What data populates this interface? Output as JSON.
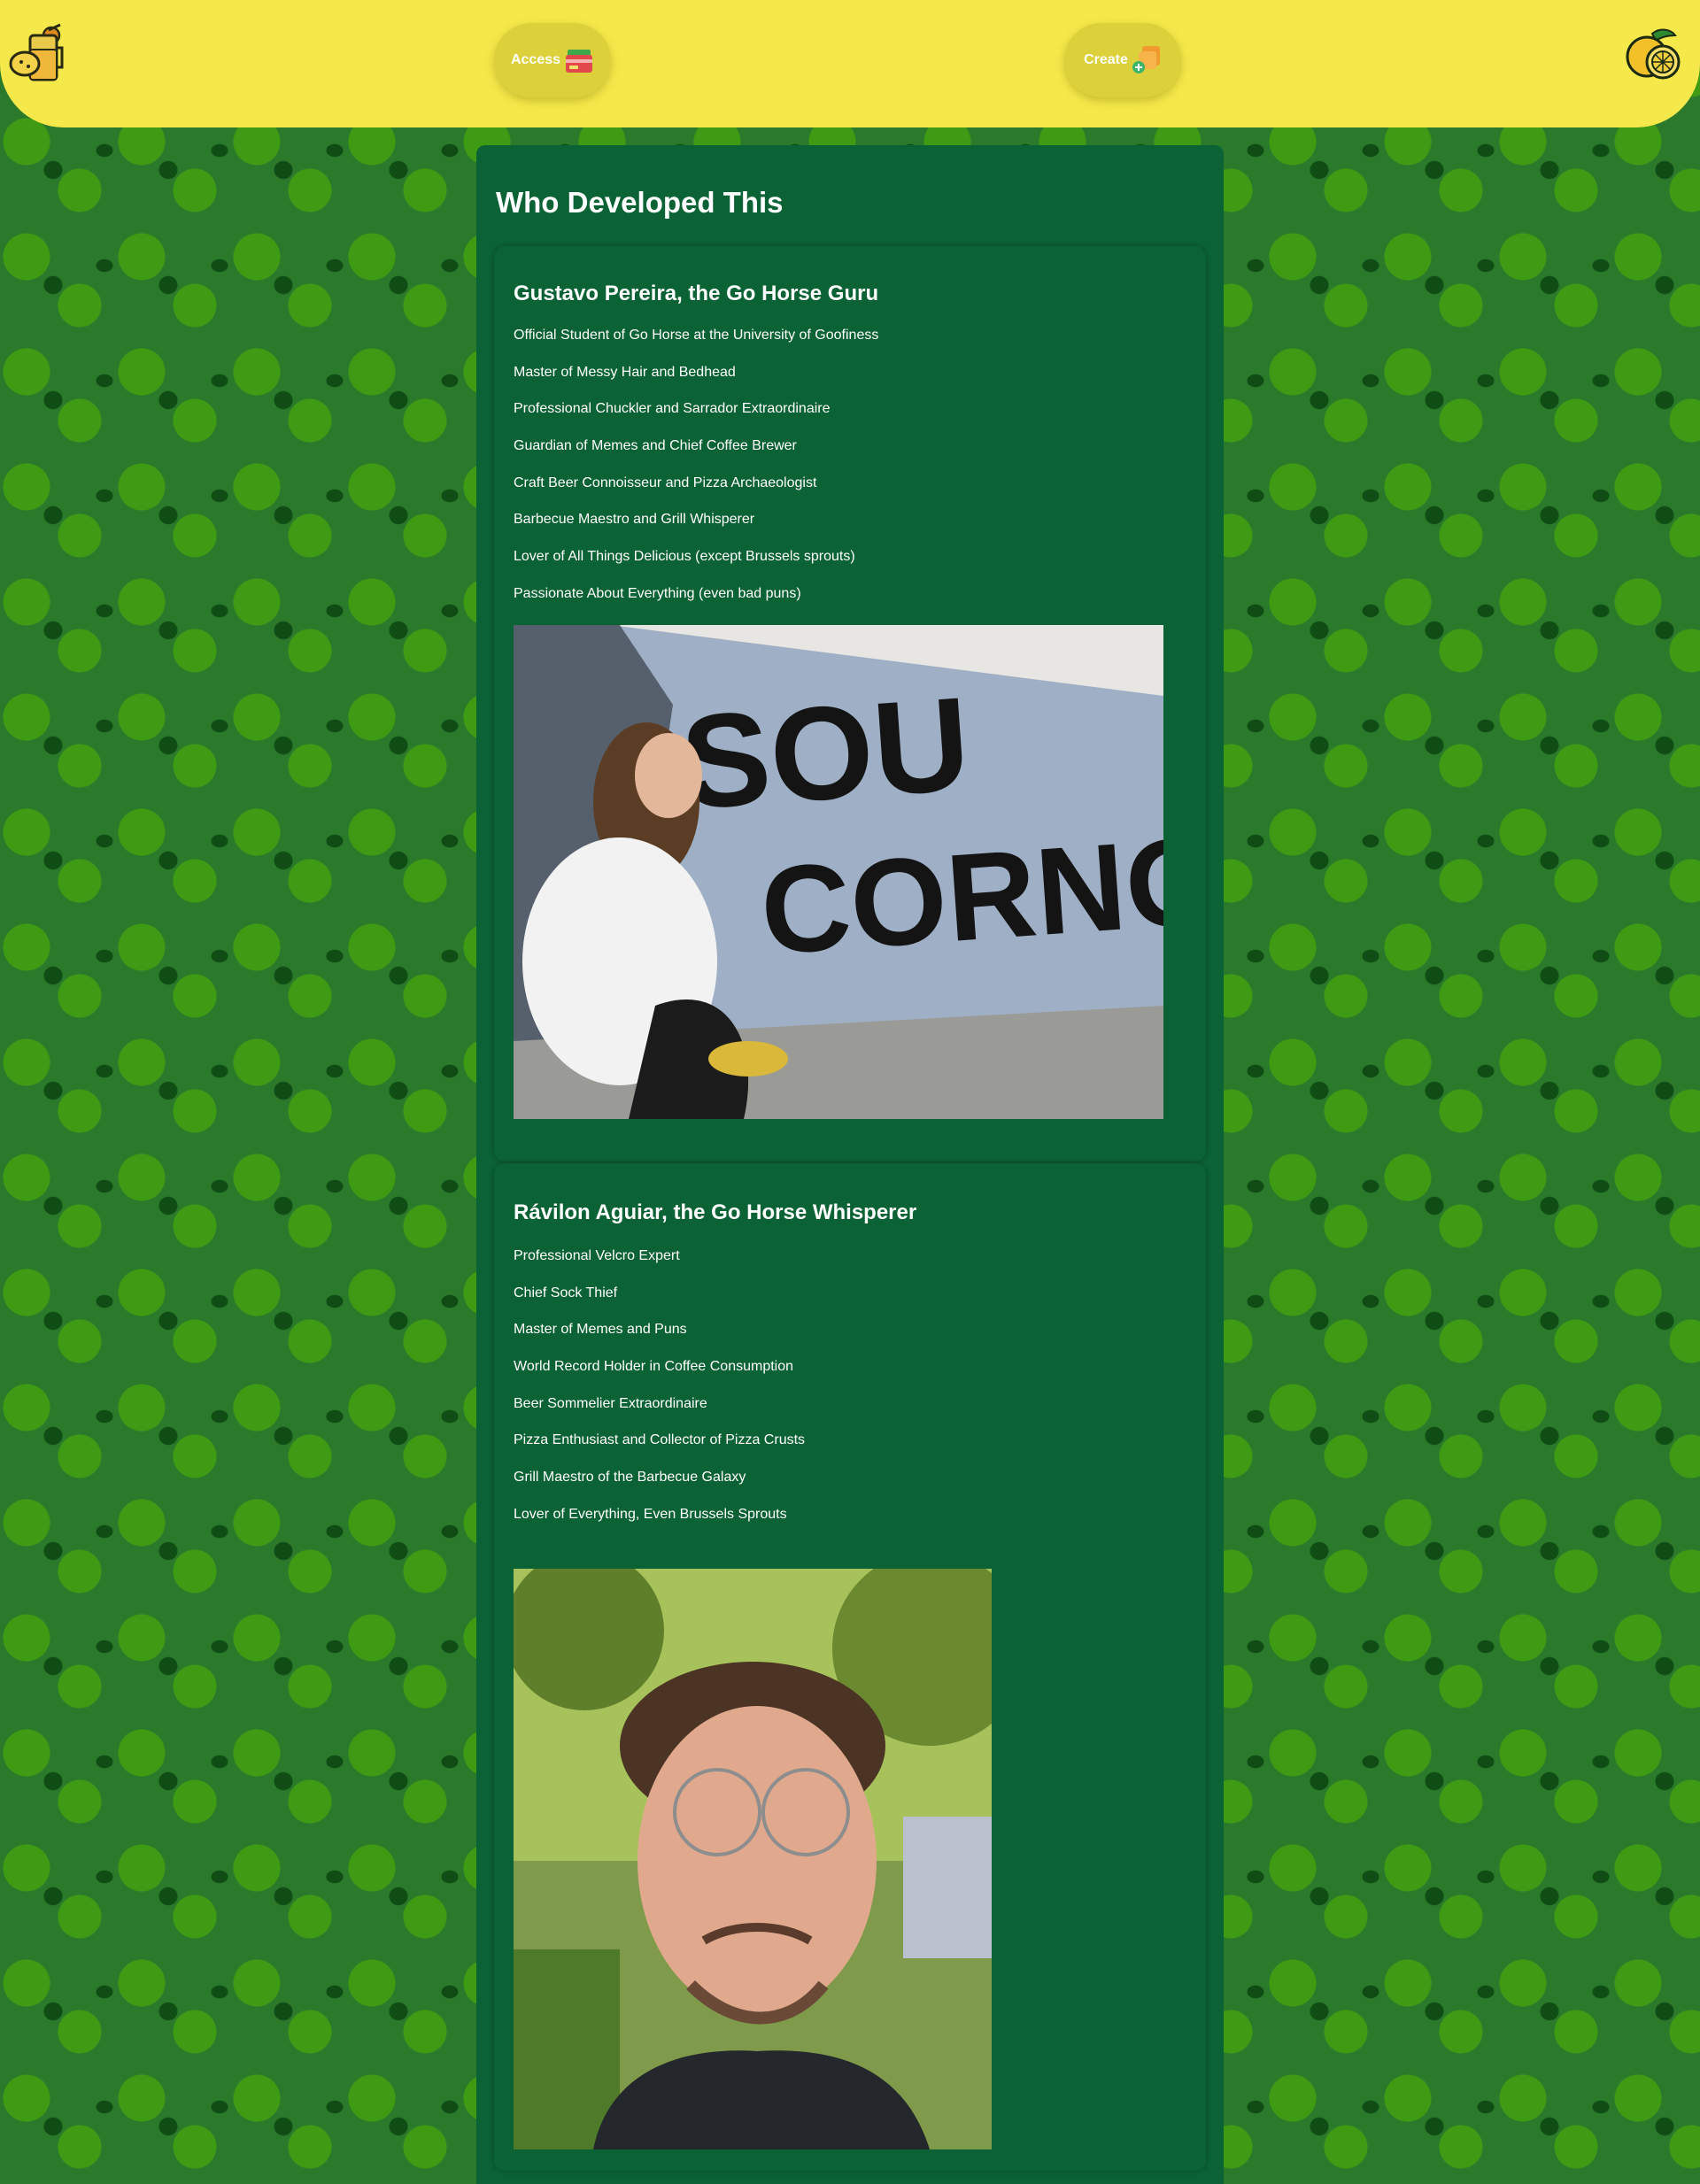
{
  "header": {
    "access_label": "Access",
    "create_label": "Create",
    "logo_left_icon": "lemonade-glass-icon",
    "logo_right_icon": "lemon-icon",
    "background_color": "#f5e84a",
    "button_color": "#dcd13a"
  },
  "page": {
    "title": "Who Developed This",
    "background_pattern": "green-lime-pattern",
    "panel_color": "#0b6234"
  },
  "developers": [
    {
      "name": "Gustavo Pereira, the Go Horse Guru",
      "traits": [
        "Official Student of Go Horse at the University of Goofiness",
        "Master of Messy Hair and Bedhead",
        "Professional Chuckler and Sarrador Extraordinaire",
        "Guardian of Memes and Chief Coffee Brewer",
        "Craft Beer Connoisseur and Pizza Archaeologist",
        "Barbecue Maestro and Grill Whisperer",
        "Lover of All Things Delicious (except Brussels sprouts)",
        "Passionate About Everything (even bad puns)"
      ],
      "photo_icon": "developer-photo",
      "photo_graffiti": [
        "SOU",
        "CORNO"
      ]
    },
    {
      "name": "Rávilon Aguiar, the Go Horse Whisperer",
      "traits": [
        "Professional Velcro Expert",
        "Chief Sock Thief",
        "Master of Memes and Puns",
        "World Record Holder in Coffee Consumption",
        "Beer Sommelier Extraordinaire",
        "Pizza Enthusiast and Collector of Pizza Crusts",
        "Grill Maestro of the Barbecue Galaxy",
        "Lover of Everything, Even Brussels Sprouts"
      ],
      "photo_icon": "developer-photo"
    }
  ]
}
